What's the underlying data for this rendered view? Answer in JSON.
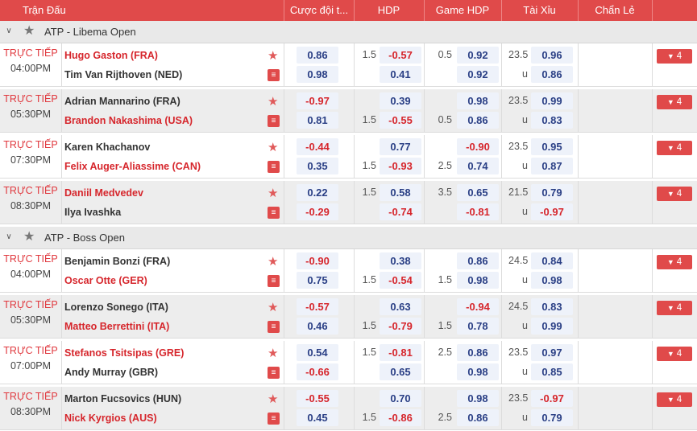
{
  "header": {
    "columns": [
      "Trận Đấu",
      "Cược đội t...",
      "HDP",
      "Game HDP",
      "Tài Xỉu",
      "Chẩn Lẻ"
    ]
  },
  "colors": {
    "accent": "#e04a4a",
    "negative": "#d6262c",
    "positive": "#2a3f85"
  },
  "leagues": [
    {
      "name": "ATP - Libema Open",
      "matches": [
        {
          "live": "TRỰC TIẾP",
          "time": "04:00PM",
          "home": "Hugo Gaston (FRA)",
          "away": "Tim Van Rijthoven (NED)",
          "home_red": true,
          "away_red": false,
          "ml": [
            "0.86",
            "0.98"
          ],
          "hdp_line": "1.5",
          "hdp": [
            "-0.57",
            "0.41"
          ],
          "game_line": "0.5",
          "game": [
            "0.92",
            "0.92"
          ],
          "ou_line": "23.5",
          "ou_u": "u",
          "ou": [
            "0.96",
            "0.86"
          ],
          "more": "4"
        },
        {
          "live": "TRỰC TIẾP",
          "time": "05:30PM",
          "home": "Adrian Mannarino (FRA)",
          "away": "Brandon Nakashima (USA)",
          "home_red": false,
          "away_red": true,
          "ml": [
            "-0.97",
            "0.81"
          ],
          "hdp_line": "1.5",
          "hdp": [
            "0.39",
            "-0.55"
          ],
          "game_line": "0.5",
          "game": [
            "0.98",
            "0.86"
          ],
          "ou_line": "23.5",
          "ou_u": "u",
          "ou": [
            "0.99",
            "0.83"
          ],
          "more": "4"
        },
        {
          "live": "TRỰC TIẾP",
          "time": "07:30PM",
          "home": "Karen Khachanov",
          "away": "Felix Auger-Aliassime (CAN)",
          "home_red": false,
          "away_red": true,
          "ml": [
            "-0.44",
            "0.35"
          ],
          "hdp_line": "1.5",
          "hdp": [
            "0.77",
            "-0.93"
          ],
          "game_line": "2.5",
          "game": [
            "-0.90",
            "0.74"
          ],
          "ou_line": "23.5",
          "ou_u": "u",
          "ou": [
            "0.95",
            "0.87"
          ],
          "more": "4"
        },
        {
          "live": "TRỰC TIẾP",
          "time": "08:30PM",
          "home": "Daniil Medvedev",
          "away": "Ilya Ivashka",
          "home_red": true,
          "away_red": false,
          "ml": [
            "0.22",
            "-0.29"
          ],
          "hdp_line": "1.5",
          "hdp": [
            "0.58",
            "-0.74"
          ],
          "game_line": "3.5",
          "game": [
            "0.65",
            "-0.81"
          ],
          "ou_line": "21.5",
          "ou_u": "u",
          "ou": [
            "0.79",
            "-0.97"
          ],
          "more": "4"
        }
      ]
    },
    {
      "name": "ATP - Boss Open",
      "matches": [
        {
          "live": "TRỰC TIẾP",
          "time": "04:00PM",
          "home": "Benjamin Bonzi (FRA)",
          "away": "Oscar Otte (GER)",
          "home_red": false,
          "away_red": true,
          "ml": [
            "-0.90",
            "0.75"
          ],
          "hdp_line": "1.5",
          "hdp": [
            "0.38",
            "-0.54"
          ],
          "game_line": "1.5",
          "game": [
            "0.86",
            "0.98"
          ],
          "ou_line": "24.5",
          "ou_u": "u",
          "ou": [
            "0.84",
            "0.98"
          ],
          "more": "4"
        },
        {
          "live": "TRỰC TIẾP",
          "time": "05:30PM",
          "home": "Lorenzo Sonego (ITA)",
          "away": "Matteo Berrettini (ITA)",
          "home_red": false,
          "away_red": true,
          "ml": [
            "-0.57",
            "0.46"
          ],
          "hdp_line": "1.5",
          "hdp": [
            "0.63",
            "-0.79"
          ],
          "game_line": "1.5",
          "game": [
            "-0.94",
            "0.78"
          ],
          "ou_line": "24.5",
          "ou_u": "u",
          "ou": [
            "0.83",
            "0.99"
          ],
          "more": "4"
        },
        {
          "live": "TRỰC TIẾP",
          "time": "07:00PM",
          "home": "Stefanos Tsitsipas (GRE)",
          "away": "Andy Murray (GBR)",
          "home_red": true,
          "away_red": false,
          "ml": [
            "0.54",
            "-0.66"
          ],
          "hdp_line": "1.5",
          "hdp": [
            "-0.81",
            "0.65"
          ],
          "game_line": "2.5",
          "game": [
            "0.86",
            "0.98"
          ],
          "ou_line": "23.5",
          "ou_u": "u",
          "ou": [
            "0.97",
            "0.85"
          ],
          "more": "4"
        },
        {
          "live": "TRỰC TIẾP",
          "time": "08:30PM",
          "home": "Marton Fucsovics (HUN)",
          "away": "Nick Kyrgios (AUS)",
          "home_red": false,
          "away_red": true,
          "ml": [
            "-0.55",
            "0.45"
          ],
          "hdp_line": "1.5",
          "hdp": [
            "0.70",
            "-0.86"
          ],
          "game_line": "2.5",
          "game": [
            "0.98",
            "0.86"
          ],
          "ou_line": "23.5",
          "ou_u": "u",
          "ou": [
            "-0.97",
            "0.79"
          ],
          "more": "4"
        }
      ]
    }
  ]
}
